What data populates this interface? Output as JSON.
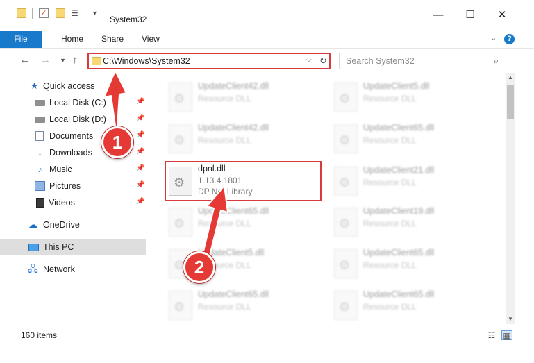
{
  "window": {
    "title": "System32"
  },
  "window_controls": {
    "minimize": "—",
    "maximize": "☐",
    "close": "✕"
  },
  "ribbon": {
    "tabs": [
      "File",
      "Home",
      "Share",
      "View"
    ],
    "help": "?"
  },
  "address": {
    "path": "C:\\Windows\\System32"
  },
  "search": {
    "placeholder": "Search System32"
  },
  "nav": {
    "items": [
      {
        "label": "Quick access",
        "icon": "star-icon"
      },
      {
        "label": "Local Disk (C:)",
        "icon": "drive-icon",
        "pinned": true
      },
      {
        "label": "Local Disk (D:)",
        "icon": "drive-icon",
        "pinned": true
      },
      {
        "label": "Documents",
        "icon": "documents-icon",
        "pinned": true
      },
      {
        "label": "Downloads",
        "icon": "downloads-icon",
        "pinned": true
      },
      {
        "label": "Music",
        "icon": "music-icon",
        "pinned": true
      },
      {
        "label": "Pictures",
        "icon": "pictures-icon",
        "pinned": true
      },
      {
        "label": "Videos",
        "icon": "videos-icon",
        "pinned": true
      },
      {
        "label": "OneDrive",
        "icon": "cloud-icon"
      },
      {
        "label": "This PC",
        "icon": "computer-icon",
        "selected": true
      },
      {
        "label": "Network",
        "icon": "network-icon"
      }
    ]
  },
  "files": [
    {
      "name": "UpdateClient42.dll",
      "type": "Resource DLL"
    },
    {
      "name": "UpdateClient5.dll",
      "type": "Resource DLL"
    },
    {
      "name": "UpdateClient42.dll",
      "type": "Resource DLL"
    },
    {
      "name": "UpdateClient65.dll",
      "type": "Resource DLL"
    },
    {
      "name": "dpnl.dll",
      "version": "1.13.4.1801",
      "type": "DP Net Library",
      "highlighted": true
    },
    {
      "name": "UpdateClient21.dll",
      "type": "Resource DLL"
    },
    {
      "name": "UpdateClient65.dll",
      "type": "Resource DLL"
    },
    {
      "name": "UpdateClient19.dll",
      "type": "Resource DLL"
    },
    {
      "name": "UpdateClient5.dll",
      "type": "Resource DLL"
    },
    {
      "name": "UpdateClient65.dll",
      "type": "Resource DLL"
    },
    {
      "name": "UpdateClient65.dll",
      "type": "Resource DLL"
    },
    {
      "name": "UpdateClient65.dll",
      "type": "Resource DLL"
    }
  ],
  "status": {
    "item_count": "160 items"
  },
  "annotations": {
    "step1": "1",
    "step2": "2",
    "color": "#e53935"
  },
  "colors": {
    "accent": "#1979ca",
    "highlight": "#d83b3b",
    "selected": "#dedede"
  }
}
